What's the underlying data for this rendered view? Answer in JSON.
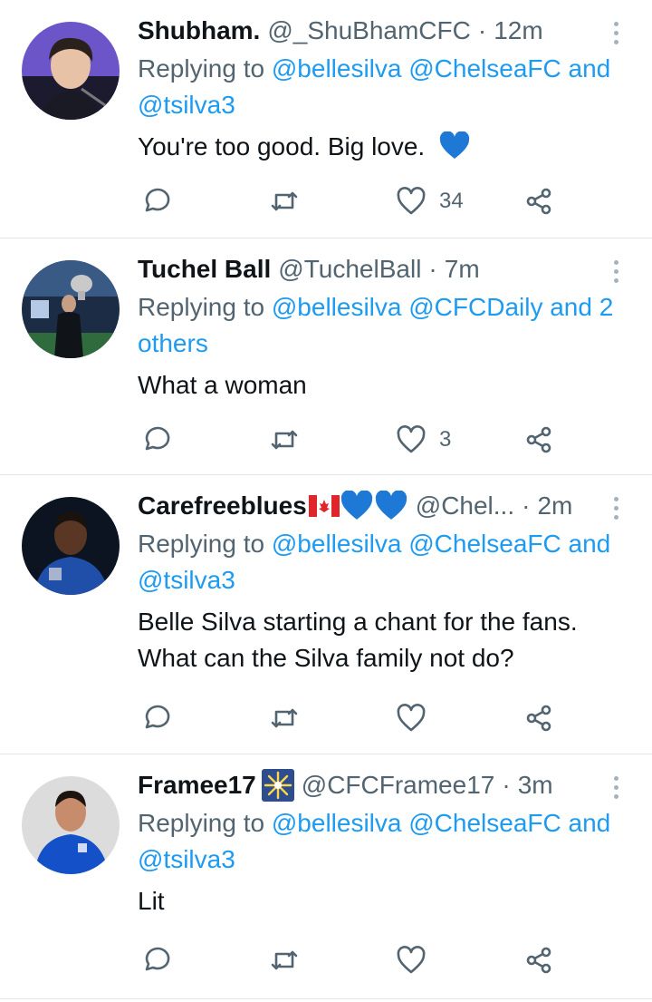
{
  "tweets": [
    {
      "name": "Shubham.",
      "handle": "@_ShuBhamCFC",
      "time": "12m",
      "replying_prefix": "Replying to",
      "mentions_line1": "@bellesilva @ChelseaFC and",
      "mentions_line2": "@tsilva3",
      "text_line1": "You're too good. Big love.",
      "text_line2": "",
      "likes": "34",
      "avatar_icon": "person-avatar"
    },
    {
      "name": "Tuchel Ball",
      "handle": "@TuchelBall",
      "time": "7m",
      "replying_prefix": "Replying to",
      "mentions_line1": "@bellesilva @CFCDaily and 2",
      "mentions_line2": "others",
      "text_line1": "What a woman",
      "text_line2": "",
      "likes": "3",
      "avatar_icon": "trophy-stadium-avatar"
    },
    {
      "name": "Carefreeblues",
      "handle": "@Chel...",
      "time": "2m",
      "replying_prefix": "Replying to",
      "mentions_line1": "@bellesilva @ChelseaFC and",
      "mentions_line2": "@tsilva3",
      "text_line1": "Belle Silva starting a chant for the fans.",
      "text_line2": "What can the Silva family not do?",
      "likes": "",
      "avatar_icon": "player-avatar"
    },
    {
      "name": "Framee17",
      "handle": "@CFCFramee17",
      "time": "3m",
      "replying_prefix": "Replying to",
      "mentions_line1": "@bellesilva @ChelseaFC and",
      "mentions_line2": "@tsilva3",
      "text_line1": "Lit",
      "text_line2": "",
      "likes": "",
      "avatar_icon": "player-kit-avatar"
    }
  ],
  "separator": "·",
  "colors": {
    "link": "#1d9bf0",
    "muted": "#536471",
    "emoji_heart": "#1d78d6"
  }
}
